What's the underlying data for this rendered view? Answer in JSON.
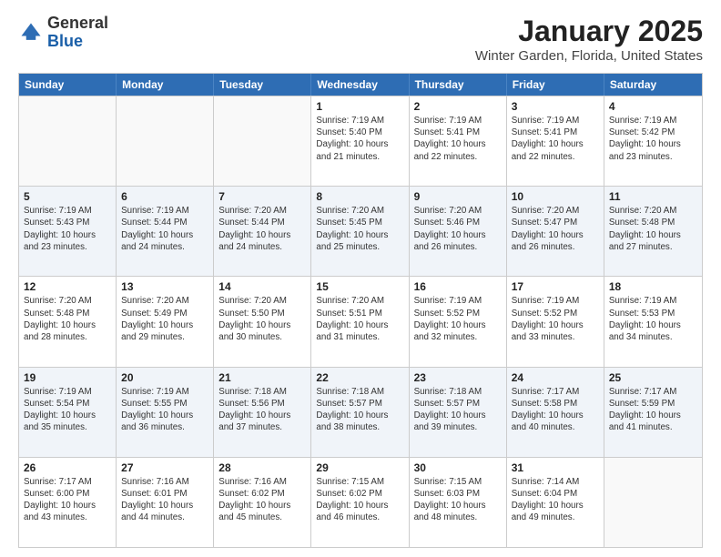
{
  "header": {
    "logo": {
      "line1": "General",
      "line2": "Blue"
    },
    "title": "January 2025",
    "location": "Winter Garden, Florida, United States"
  },
  "days_of_week": [
    "Sunday",
    "Monday",
    "Tuesday",
    "Wednesday",
    "Thursday",
    "Friday",
    "Saturday"
  ],
  "rows": [
    {
      "cells": [
        {
          "empty": true
        },
        {
          "empty": true
        },
        {
          "empty": true
        },
        {
          "day": "1",
          "lines": [
            "Sunrise: 7:19 AM",
            "Sunset: 5:40 PM",
            "Daylight: 10 hours",
            "and 21 minutes."
          ]
        },
        {
          "day": "2",
          "lines": [
            "Sunrise: 7:19 AM",
            "Sunset: 5:41 PM",
            "Daylight: 10 hours",
            "and 22 minutes."
          ]
        },
        {
          "day": "3",
          "lines": [
            "Sunrise: 7:19 AM",
            "Sunset: 5:41 PM",
            "Daylight: 10 hours",
            "and 22 minutes."
          ]
        },
        {
          "day": "4",
          "lines": [
            "Sunrise: 7:19 AM",
            "Sunset: 5:42 PM",
            "Daylight: 10 hours",
            "and 23 minutes."
          ]
        }
      ]
    },
    {
      "alt": true,
      "cells": [
        {
          "day": "5",
          "lines": [
            "Sunrise: 7:19 AM",
            "Sunset: 5:43 PM",
            "Daylight: 10 hours",
            "and 23 minutes."
          ]
        },
        {
          "day": "6",
          "lines": [
            "Sunrise: 7:19 AM",
            "Sunset: 5:44 PM",
            "Daylight: 10 hours",
            "and 24 minutes."
          ]
        },
        {
          "day": "7",
          "lines": [
            "Sunrise: 7:20 AM",
            "Sunset: 5:44 PM",
            "Daylight: 10 hours",
            "and 24 minutes."
          ]
        },
        {
          "day": "8",
          "lines": [
            "Sunrise: 7:20 AM",
            "Sunset: 5:45 PM",
            "Daylight: 10 hours",
            "and 25 minutes."
          ]
        },
        {
          "day": "9",
          "lines": [
            "Sunrise: 7:20 AM",
            "Sunset: 5:46 PM",
            "Daylight: 10 hours",
            "and 26 minutes."
          ]
        },
        {
          "day": "10",
          "lines": [
            "Sunrise: 7:20 AM",
            "Sunset: 5:47 PM",
            "Daylight: 10 hours",
            "and 26 minutes."
          ]
        },
        {
          "day": "11",
          "lines": [
            "Sunrise: 7:20 AM",
            "Sunset: 5:48 PM",
            "Daylight: 10 hours",
            "and 27 minutes."
          ]
        }
      ]
    },
    {
      "cells": [
        {
          "day": "12",
          "lines": [
            "Sunrise: 7:20 AM",
            "Sunset: 5:48 PM",
            "Daylight: 10 hours",
            "and 28 minutes."
          ]
        },
        {
          "day": "13",
          "lines": [
            "Sunrise: 7:20 AM",
            "Sunset: 5:49 PM",
            "Daylight: 10 hours",
            "and 29 minutes."
          ]
        },
        {
          "day": "14",
          "lines": [
            "Sunrise: 7:20 AM",
            "Sunset: 5:50 PM",
            "Daylight: 10 hours",
            "and 30 minutes."
          ]
        },
        {
          "day": "15",
          "lines": [
            "Sunrise: 7:20 AM",
            "Sunset: 5:51 PM",
            "Daylight: 10 hours",
            "and 31 minutes."
          ]
        },
        {
          "day": "16",
          "lines": [
            "Sunrise: 7:19 AM",
            "Sunset: 5:52 PM",
            "Daylight: 10 hours",
            "and 32 minutes."
          ]
        },
        {
          "day": "17",
          "lines": [
            "Sunrise: 7:19 AM",
            "Sunset: 5:52 PM",
            "Daylight: 10 hours",
            "and 33 minutes."
          ]
        },
        {
          "day": "18",
          "lines": [
            "Sunrise: 7:19 AM",
            "Sunset: 5:53 PM",
            "Daylight: 10 hours",
            "and 34 minutes."
          ]
        }
      ]
    },
    {
      "alt": true,
      "cells": [
        {
          "day": "19",
          "lines": [
            "Sunrise: 7:19 AM",
            "Sunset: 5:54 PM",
            "Daylight: 10 hours",
            "and 35 minutes."
          ]
        },
        {
          "day": "20",
          "lines": [
            "Sunrise: 7:19 AM",
            "Sunset: 5:55 PM",
            "Daylight: 10 hours",
            "and 36 minutes."
          ]
        },
        {
          "day": "21",
          "lines": [
            "Sunrise: 7:18 AM",
            "Sunset: 5:56 PM",
            "Daylight: 10 hours",
            "and 37 minutes."
          ]
        },
        {
          "day": "22",
          "lines": [
            "Sunrise: 7:18 AM",
            "Sunset: 5:57 PM",
            "Daylight: 10 hours",
            "and 38 minutes."
          ]
        },
        {
          "day": "23",
          "lines": [
            "Sunrise: 7:18 AM",
            "Sunset: 5:57 PM",
            "Daylight: 10 hours",
            "and 39 minutes."
          ]
        },
        {
          "day": "24",
          "lines": [
            "Sunrise: 7:17 AM",
            "Sunset: 5:58 PM",
            "Daylight: 10 hours",
            "and 40 minutes."
          ]
        },
        {
          "day": "25",
          "lines": [
            "Sunrise: 7:17 AM",
            "Sunset: 5:59 PM",
            "Daylight: 10 hours",
            "and 41 minutes."
          ]
        }
      ]
    },
    {
      "cells": [
        {
          "day": "26",
          "lines": [
            "Sunrise: 7:17 AM",
            "Sunset: 6:00 PM",
            "Daylight: 10 hours",
            "and 43 minutes."
          ]
        },
        {
          "day": "27",
          "lines": [
            "Sunrise: 7:16 AM",
            "Sunset: 6:01 PM",
            "Daylight: 10 hours",
            "and 44 minutes."
          ]
        },
        {
          "day": "28",
          "lines": [
            "Sunrise: 7:16 AM",
            "Sunset: 6:02 PM",
            "Daylight: 10 hours",
            "and 45 minutes."
          ]
        },
        {
          "day": "29",
          "lines": [
            "Sunrise: 7:15 AM",
            "Sunset: 6:02 PM",
            "Daylight: 10 hours",
            "and 46 minutes."
          ]
        },
        {
          "day": "30",
          "lines": [
            "Sunrise: 7:15 AM",
            "Sunset: 6:03 PM",
            "Daylight: 10 hours",
            "and 48 minutes."
          ]
        },
        {
          "day": "31",
          "lines": [
            "Sunrise: 7:14 AM",
            "Sunset: 6:04 PM",
            "Daylight: 10 hours",
            "and 49 minutes."
          ]
        },
        {
          "empty": true
        }
      ]
    }
  ]
}
